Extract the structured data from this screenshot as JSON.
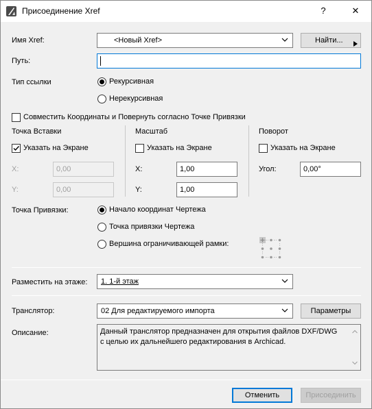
{
  "window": {
    "title": "Присоединение Xref",
    "help_label": "?",
    "close_label": "✕"
  },
  "xref": {
    "name_label": "Имя Xref:",
    "name_value": "<Новый Xref>",
    "browse_label": "Найти...",
    "path_label": "Путь:",
    "path_value": ""
  },
  "link_type": {
    "label": "Тип ссылки",
    "options": [
      "Рекурсивная",
      "Нерекурсивная"
    ],
    "selected": "Рекурсивная"
  },
  "align": {
    "label": "Совместить Координаты и Повернуть согласно Точке Привязки",
    "checked": false
  },
  "insert_point": {
    "heading": "Точка Вставки",
    "specify_label": "Указать на Экране",
    "specify_checked": true,
    "x_label": "X:",
    "x_value": "0,00",
    "y_label": "Y:",
    "y_value": "0,00"
  },
  "scale": {
    "heading": "Масштаб",
    "specify_label": "Указать на Экране",
    "specify_checked": false,
    "x_label": "X:",
    "x_value": "1,00",
    "y_label": "Y:",
    "y_value": "1,00"
  },
  "rotation": {
    "heading": "Поворот",
    "specify_label": "Указать на Экране",
    "specify_checked": false,
    "angle_label": "Угол:",
    "angle_value": "0,00°"
  },
  "anchor": {
    "label": "Точка Привязки:",
    "options": [
      "Начало координат Чертежа",
      "Точка привязки Чертежа",
      "Вершина ограничивающей рамки:"
    ],
    "selected": "Начало координат Чертежа"
  },
  "story": {
    "label": "Разместить на этаже:",
    "value": "1. 1-й этаж"
  },
  "translator": {
    "label": "Транслятор:",
    "value": "02 Для редактируемого импорта",
    "params_label": "Параметры",
    "description_label": "Описание:",
    "description": "Данный транслятор предназначен для открытия файлов DXF/DWG\nс целью их дальнейшего редактирования в Archicad."
  },
  "footer": {
    "cancel_label": "Отменить",
    "attach_label": "Присоединить"
  },
  "colors": {
    "accent": "#0078d7",
    "disabled_text": "#a0a0a0"
  }
}
